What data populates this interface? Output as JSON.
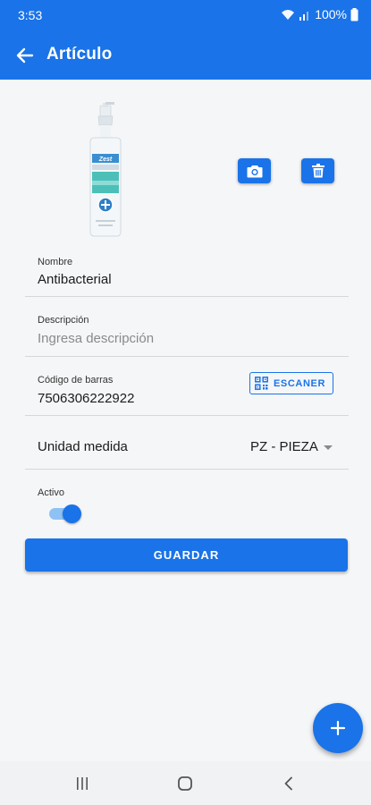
{
  "status_bar": {
    "time": "3:53",
    "battery": "100%"
  },
  "app_bar": {
    "title": "Artículo",
    "back_icon": "arrow-left-icon"
  },
  "product": {
    "image_icon": "spray-bottle-image",
    "camera_icon": "camera-icon",
    "delete_icon": "trash-icon"
  },
  "form": {
    "name": {
      "label": "Nombre",
      "value": "Antibacterial"
    },
    "description": {
      "label": "Descripción",
      "placeholder": "Ingresa descripción"
    },
    "barcode": {
      "label": "Código de barras",
      "value": "7506306222922",
      "scan_label": "ESCANER",
      "scan_icon": "qr-code-icon"
    },
    "unit": {
      "label": "Unidad medida",
      "selected": "PZ - PIEZA"
    },
    "active": {
      "label": "Activo",
      "checked": true
    },
    "save_label": "GUARDAR"
  },
  "fab": {
    "icon": "plus-icon"
  },
  "colors": {
    "primary": "#1a73e8",
    "switch_track": "#8ec2f5",
    "background": "#f5f6f8"
  }
}
